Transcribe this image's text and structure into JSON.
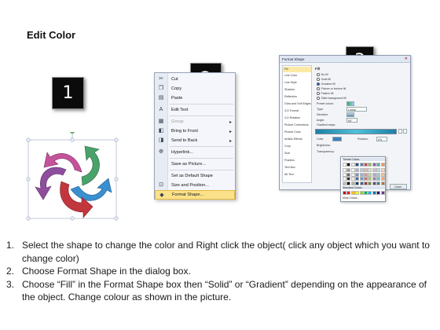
{
  "title": "Edit Color",
  "steps": {
    "one": "1",
    "two": "2",
    "three": "3"
  },
  "context_menu": {
    "items": [
      {
        "label": "Cut",
        "icon": "scissors-icon"
      },
      {
        "label": "Copy",
        "icon": "copy-icon"
      },
      {
        "label": "Paste",
        "icon": "paste-icon"
      },
      {
        "label": "Edit Text",
        "icon": "edit-text-icon"
      },
      {
        "label": "Group",
        "icon": "group-icon"
      },
      {
        "label": "Bring to Front",
        "icon": "bring-front-icon"
      },
      {
        "label": "Send to Back",
        "icon": "send-back-icon"
      },
      {
        "label": "Hyperlink...",
        "icon": "hyperlink-icon"
      },
      {
        "label": "Save as Picture...",
        "icon": ""
      },
      {
        "label": "Set as Default Shape",
        "icon": ""
      },
      {
        "label": "Size and Position...",
        "icon": "size-position-icon"
      },
      {
        "label": "Format Shape...",
        "icon": "format-shape-icon"
      }
    ]
  },
  "format_dialog": {
    "title": "Format Shape",
    "nav": [
      "Fill",
      "Line Color",
      "Line Style",
      "Shadow",
      "Reflection",
      "Glow and Soft Edges",
      "3-D Format",
      "3-D Rotation",
      "Picture Corrections",
      "Picture Color",
      "Artistic Effects",
      "Crop",
      "Size",
      "Position",
      "Text Box",
      "Alt Text"
    ],
    "section": "Fill",
    "options": [
      "No fill",
      "Solid fill",
      "Gradient fill",
      "Picture or texture fill",
      "Pattern fill",
      "Slide background fill"
    ],
    "labels": {
      "preset": "Preset colors:",
      "type": "Type:",
      "type_value": "Linear",
      "direction": "Direction:",
      "angle": "Angle:",
      "angle_value": "90°",
      "stops": "Gradient stops",
      "color": "Color",
      "position": "Position:",
      "position_value": "0%",
      "brightness": "Brightness:",
      "transparency": "Transparency:",
      "rotate": "Rotate with shape"
    },
    "close_label": "Close"
  },
  "color_palette": {
    "theme_label": "Theme Colors",
    "standard_label": "Standard Colors",
    "more_label": "More Colors...",
    "theme_top": [
      "#ffffff",
      "#000000",
      "#eeece1",
      "#1f497d",
      "#4f81bd",
      "#c0504d",
      "#9bbb59",
      "#8064a2",
      "#4bacc6",
      "#f79646"
    ],
    "standard": [
      "#c00000",
      "#ff0000",
      "#ffc000",
      "#ffff00",
      "#92d050",
      "#00b050",
      "#00b0f0",
      "#0070c0",
      "#002060",
      "#7030a0"
    ]
  },
  "instructions": [
    {
      "num": "1.",
      "text": "Select the shape to change the color and Right click the object( click any object which you want to change color)"
    },
    {
      "num": "2.",
      "text": "Choose Format Shape in the dialog box."
    },
    {
      "num": "3.",
      "text": "Choose “Fill” in the Format Shape box then “Solid” or “Gradient” depending on the appearance of the object. Change colour as shown in the picture."
    }
  ]
}
